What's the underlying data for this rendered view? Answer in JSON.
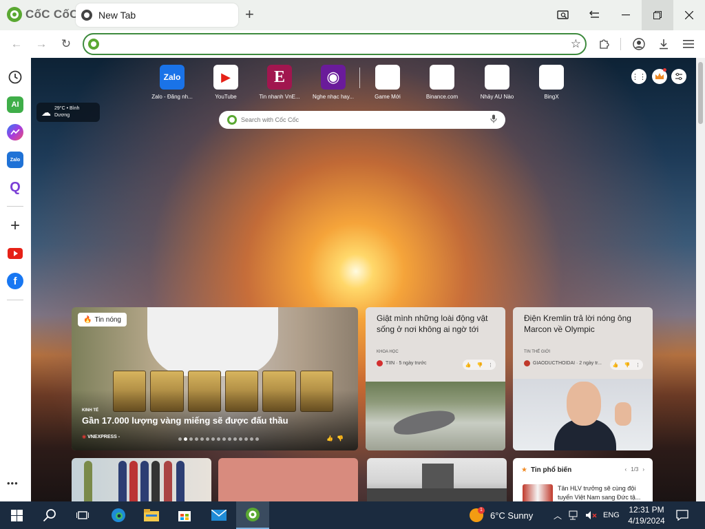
{
  "browser": {
    "brand": "CốC CốC",
    "tab_title": "New Tab",
    "new_tab": "+",
    "address_value": "",
    "icons": {
      "search_tab": "tab-search-icon",
      "back_history": "tab-history-icon",
      "extensions": "puzzle-icon",
      "profile": "profile-icon",
      "download": "download-icon",
      "menu": "hamburger-icon"
    }
  },
  "sidebar": {
    "items": [
      {
        "name": "history",
        "label": ""
      },
      {
        "name": "ai",
        "label": "AI",
        "color": "#3fae49"
      },
      {
        "name": "messenger",
        "label": "",
        "color": "#8a56e8"
      },
      {
        "name": "zalo",
        "label": "Zalo",
        "color": "#1f72d6"
      },
      {
        "name": "qr",
        "label": "Q",
        "color": "#7b3fd6"
      },
      {
        "name": "add",
        "label": "+"
      },
      {
        "name": "youtube",
        "label": "",
        "color": "#e62117"
      },
      {
        "name": "facebook",
        "label": "f",
        "color": "#1877f2"
      }
    ],
    "more": "•••"
  },
  "newtab": {
    "shortcuts": [
      {
        "label": "Zalo - Đăng nh...",
        "tile": "Zalo",
        "color": "#1a73e8",
        "text_color": "#ffffff"
      },
      {
        "label": "YouTube",
        "tile": "▶",
        "color": "#ffffff",
        "text_color": "#e62117"
      },
      {
        "label": "Tin nhanh VnE...",
        "tile": "E",
        "color": "#a1164f",
        "text_color": "#ffffff"
      },
      {
        "label": "Nghe nhạc hay...",
        "tile": "◉",
        "color": "#6a1b9a",
        "text_color": "#ffffff"
      },
      {
        "label": "Game Mới",
        "tile": "",
        "color": "#ffffff",
        "text_color": "#333333"
      },
      {
        "label": "Binance.com",
        "tile": "",
        "color": "#ffffff",
        "text_color": "#333333"
      },
      {
        "label": "Nhảy AU Nào",
        "tile": "",
        "color": "#ffffff",
        "text_color": "#333333"
      },
      {
        "label": "BingX",
        "tile": "",
        "color": "#ffffff",
        "text_color": "#333333"
      }
    ],
    "weather": {
      "line1": "29°C • Bình",
      "line2": "Dương"
    },
    "search_placeholder": "Search with Cốc Cốc"
  },
  "news": {
    "hot_badge": "Tin nóng",
    "featured": {
      "category": "KINH TẾ",
      "title": "Gần 17.000 lượng vàng miếng sẽ được đấu thầu",
      "source": "VNEXPRESS -"
    },
    "card1": {
      "title": "Giật mình những loài động vật sống ở nơi không ai ngờ tới",
      "category": "KHOA HỌC",
      "meta": "TIIN · 5 ngày trước"
    },
    "card2": {
      "title": "Điện Kremlin trả lời nóng ông Marcon về Olympic",
      "category": "TIN THẾ GIỚI",
      "meta": "GIAODUCTHOIDAI · 2 ngày tr..."
    },
    "trending": {
      "heading": "Tin phổ biến",
      "pager": "1/3",
      "item": "Tân HLV trưởng sẽ cùng đội tuyển Việt Nam sang Đức tậ..."
    }
  },
  "taskbar": {
    "weather": "6°C  Sunny",
    "weather_badge": "1",
    "lang": "ENG",
    "time": "12:31 PM",
    "date": "4/19/2024"
  }
}
